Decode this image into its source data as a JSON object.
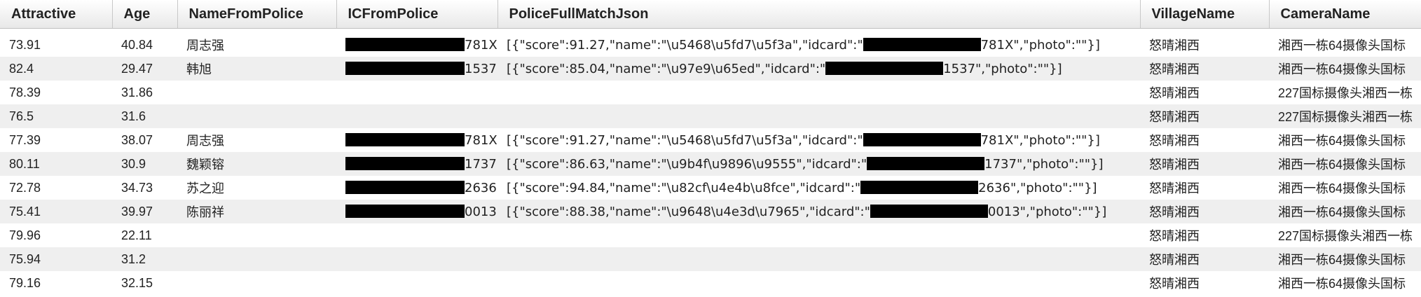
{
  "columns": [
    "Attractive",
    "Age",
    "NameFromPolice",
    "ICFromPolice",
    "PoliceFullMatchJson",
    "VillageName",
    "CameraName"
  ],
  "rows": [
    {
      "attractive": "73.91",
      "age": "40.84",
      "name": "周志强",
      "ic_suffix": "781X",
      "json": {
        "score": "91.27",
        "name_escaped": "\\u5468\\u5fd7\\u5f3a",
        "idcard_suffix": "781X"
      },
      "village": "怒晴湘西",
      "camera": "湘西一栋64摄像头国标"
    },
    {
      "attractive": "82.4",
      "age": "29.47",
      "name": "韩旭",
      "ic_suffix": "1537",
      "json": {
        "score": "85.04",
        "name_escaped": "\\u97e9\\u65ed",
        "idcard_suffix": "1537"
      },
      "village": "怒晴湘西",
      "camera": "湘西一栋64摄像头国标"
    },
    {
      "attractive": "78.39",
      "age": "31.86",
      "name": "",
      "ic_suffix": "",
      "json": null,
      "village": "怒晴湘西",
      "camera": "227国标摄像头湘西一栋"
    },
    {
      "attractive": "76.5",
      "age": "31.6",
      "name": "",
      "ic_suffix": "",
      "json": null,
      "village": "怒晴湘西",
      "camera": "227国标摄像头湘西一栋"
    },
    {
      "attractive": "77.39",
      "age": "38.07",
      "name": "周志强",
      "ic_suffix": "781X",
      "json": {
        "score": "91.27",
        "name_escaped": "\\u5468\\u5fd7\\u5f3a",
        "idcard_suffix": "781X"
      },
      "village": "怒晴湘西",
      "camera": "湘西一栋64摄像头国标"
    },
    {
      "attractive": "80.11",
      "age": "30.9",
      "name": "魏颖镕",
      "ic_suffix": "1737",
      "json": {
        "score": "86.63",
        "name_escaped": "\\u9b4f\\u9896\\u9555",
        "idcard_suffix": "1737"
      },
      "village": "怒晴湘西",
      "camera": "湘西一栋64摄像头国标"
    },
    {
      "attractive": "72.78",
      "age": "34.73",
      "name": "苏之迎",
      "ic_suffix": "2636",
      "json": {
        "score": "94.84",
        "name_escaped": "\\u82cf\\u4e4b\\u8fce",
        "idcard_suffix": "2636"
      },
      "village": "怒晴湘西",
      "camera": "湘西一栋64摄像头国标"
    },
    {
      "attractive": "75.41",
      "age": "39.97",
      "name": "陈丽祥",
      "ic_suffix": "0013",
      "json": {
        "score": "88.38",
        "name_escaped": "\\u9648\\u4e3d\\u7965",
        "idcard_suffix": "0013"
      },
      "village": "怒晴湘西",
      "camera": "湘西一栋64摄像头国标"
    },
    {
      "attractive": "79.96",
      "age": "22.11",
      "name": "",
      "ic_suffix": "",
      "json": null,
      "village": "怒晴湘西",
      "camera": "227国标摄像头湘西一栋"
    },
    {
      "attractive": "75.94",
      "age": "31.2",
      "name": "",
      "ic_suffix": "",
      "json": null,
      "village": "怒晴湘西",
      "camera": "湘西一栋64摄像头国标"
    },
    {
      "attractive": "79.16",
      "age": "32.15",
      "name": "",
      "ic_suffix": "",
      "json": null,
      "village": "怒晴湘西",
      "camera": "湘西一栋64摄像头国标"
    }
  ]
}
